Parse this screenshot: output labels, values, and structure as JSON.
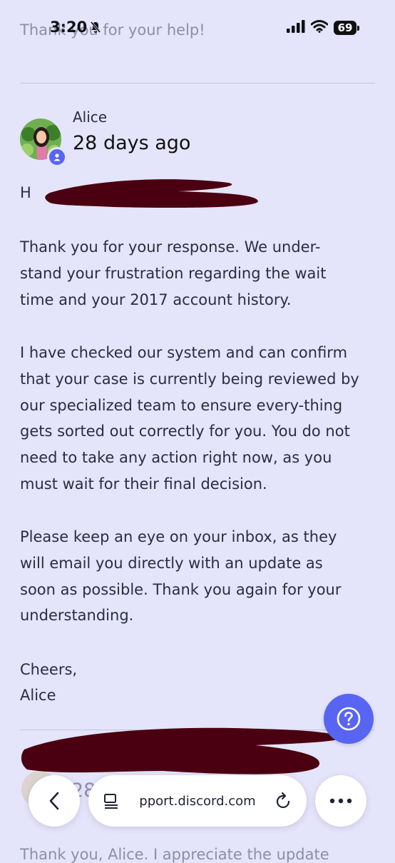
{
  "status_bar": {
    "time": "3:20",
    "battery": "69"
  },
  "previous_message": {
    "text": "Thank you for your help!"
  },
  "message": {
    "author": "Alice",
    "timestamp": "28 days ago",
    "greeting_visible": "H",
    "paragraphs": [
      "Thank you for your response. We under-stand your frustration regarding the wait time and your 2017 account history.",
      "I have checked our system and can confirm that your case is currently being reviewed by our specialized team to ensure every-thing gets sorted out correctly for you. You do not need to take any action right now, as you must wait for their final decision.",
      "Please keep an eye on your inbox, as they will email you directly with an update as soon as possible. Thank you again for your understanding."
    ],
    "signoff": "Cheers,",
    "signature": "Alice"
  },
  "next_message": {
    "timestamp_partial": "28",
    "text_partial": "Thank you, Alice. I appreciate the update"
  },
  "browser_bar": {
    "url": "pport.discord.com"
  },
  "colors": {
    "background": "#e4e4fb",
    "accent": "#5865f2",
    "redaction": "#4a0010"
  },
  "icons": {
    "status": [
      "bell-off-icon",
      "signal-icon",
      "wifi-icon",
      "battery-icon"
    ],
    "toolbar": [
      "chevron-left-icon",
      "reader-icon",
      "reload-icon",
      "more-icon"
    ],
    "help": "question-icon"
  }
}
